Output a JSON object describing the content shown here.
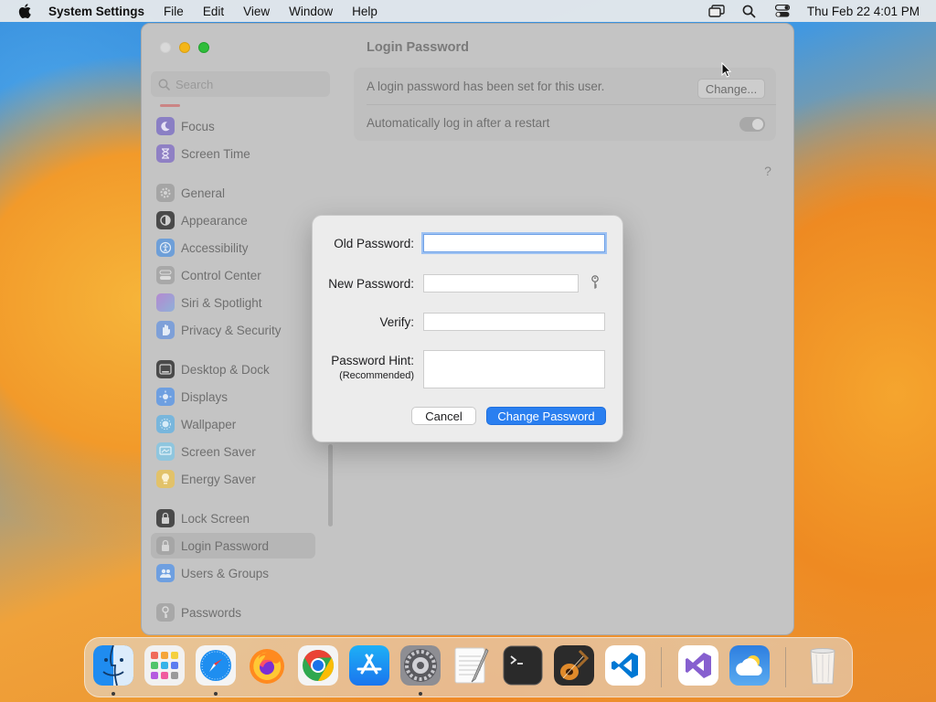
{
  "menubar": {
    "app_name": "System Settings",
    "items": [
      "File",
      "Edit",
      "View",
      "Window",
      "Help"
    ],
    "datetime": "Thu Feb 22  4:01 PM"
  },
  "window": {
    "title": "Login Password",
    "search_placeholder": "Search",
    "sidebar": [
      {
        "label": "Focus",
        "icon": "moon-icon",
        "color": "#6b5bd6"
      },
      {
        "label": "Screen Time",
        "icon": "hourglass-icon",
        "color": "#7a5bd6"
      },
      {
        "label": "General",
        "icon": "gear-icon",
        "color": "#8e8e93"
      },
      {
        "label": "Appearance",
        "icon": "appearance-icon",
        "color": "#1c1c1e"
      },
      {
        "label": "Accessibility",
        "icon": "accessibility-icon",
        "color": "#1e7cf2"
      },
      {
        "label": "Control Center",
        "icon": "control-center-icon",
        "color": "#8e8e93"
      },
      {
        "label": "Siri & Spotlight",
        "icon": "siri-icon",
        "color": "#c14bd6"
      },
      {
        "label": "Privacy & Security",
        "icon": "hand-icon",
        "color": "#3a7bf0"
      },
      {
        "label": "Desktop & Dock",
        "icon": "dock-icon",
        "color": "#2c2c2e"
      },
      {
        "label": "Displays",
        "icon": "sun-icon",
        "color": "#2d7cf5"
      },
      {
        "label": "Wallpaper",
        "icon": "wallpaper-icon",
        "color": "#38b0f0"
      },
      {
        "label": "Screen Saver",
        "icon": "screensaver-icon",
        "color": "#5ac8fa"
      },
      {
        "label": "Energy Saver",
        "icon": "bulb-icon",
        "color": "#f7b500"
      },
      {
        "label": "Lock Screen",
        "icon": "lock-icon",
        "color": "#2c2c2e"
      },
      {
        "label": "Login Password",
        "icon": "lock-icon",
        "color": "#8e8e93"
      },
      {
        "label": "Users & Groups",
        "icon": "users-icon",
        "color": "#2d7cf5"
      },
      {
        "label": "Passwords",
        "icon": "key-icon",
        "color": "#8e8e93"
      }
    ],
    "status_text": "A login password has been set for this user.",
    "change_button": "Change...",
    "auto_login_label": "Automatically log in after a restart",
    "help": "?"
  },
  "dialog": {
    "old_password_label": "Old Password:",
    "new_password_label": "New Password:",
    "verify_label": "Verify:",
    "hint_label": "Password Hint:",
    "hint_sub_label": "(Recommended)",
    "old_password_value": "",
    "new_password_value": "",
    "verify_value": "",
    "hint_value": "",
    "cancel": "Cancel",
    "submit": "Change Password"
  },
  "dock": {
    "apps": [
      "Finder",
      "Launchpad",
      "Safari",
      "Firefox",
      "Chrome",
      "App Store",
      "System Settings",
      "TextEdit",
      "Terminal",
      "GarageBand",
      "Visual Studio Code",
      "Visual Studio",
      "Weather",
      "Trash"
    ]
  },
  "colors": {
    "accent": "#2a7ff0",
    "focus_ring": "#9dc1f2"
  }
}
